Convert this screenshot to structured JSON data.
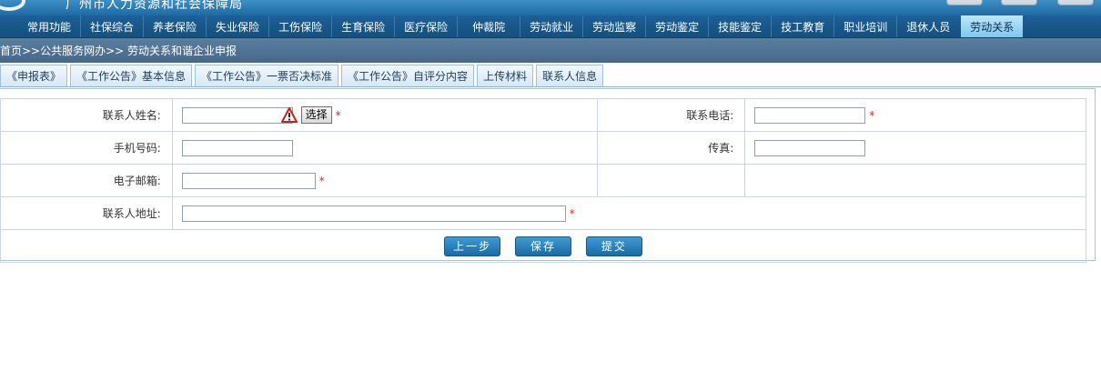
{
  "header": {
    "org_name": "广州市人力资源和社会保障局"
  },
  "nav": {
    "items": [
      "常用功能",
      "社保综合",
      "养老保险",
      "失业保险",
      "工伤保险",
      "生育保险",
      "医疗保险",
      "仲裁院",
      "劳动就业",
      "劳动监察",
      "劳动鉴定",
      "技能鉴定",
      "技工教育",
      "职业培训",
      "退休人员",
      "劳动关系"
    ],
    "active": "劳动关系"
  },
  "breadcrumb": "首页>>公共服务网办>> 劳动关系和谐企业申报",
  "tabs": [
    "《申报表》",
    "《工作公告》基本信息",
    "《工作公告》一票否决标准",
    "《工作公告》自评分内容",
    "上传材料",
    "联系人信息"
  ],
  "form": {
    "contact_name_label": "联系人姓名:",
    "contact_name_value": "",
    "select_button": "选择",
    "phone_label": "联系电话:",
    "phone_value": "",
    "mobile_label": "手机号码:",
    "mobile_value": "",
    "fax_label": "传真:",
    "fax_value": "",
    "email_label": "电子邮箱:",
    "email_value": "",
    "address_label": "联系人地址:",
    "address_value": "",
    "required_mark": "*"
  },
  "actions": {
    "prev": "上一步",
    "save": "保存",
    "submit": "提交"
  },
  "colors": {
    "nav_bg": "#1c5f97",
    "active_tab": "#7dc8ef",
    "required": "#e0231c",
    "button": "#1a6ba6"
  }
}
